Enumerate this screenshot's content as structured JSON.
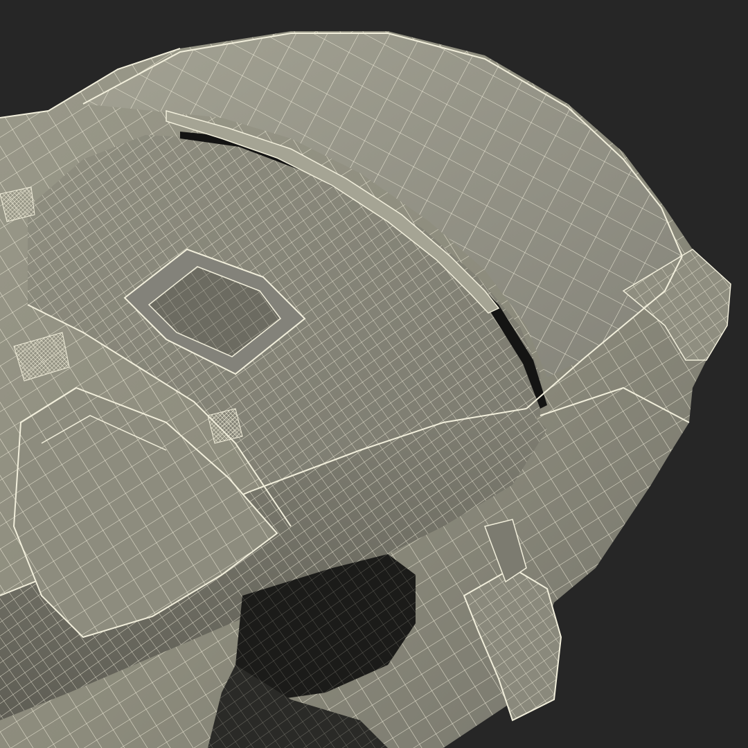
{
  "scene": {
    "subject": "car-wireframe-render",
    "background_color": "#262626",
    "body_fill_color": "#8c8b7c",
    "body_shadow_color": "#6f6e62",
    "body_highlight_color": "#a8a797",
    "wire_color": "#f2efdc",
    "cavity_color": "#1c1c1a"
  }
}
